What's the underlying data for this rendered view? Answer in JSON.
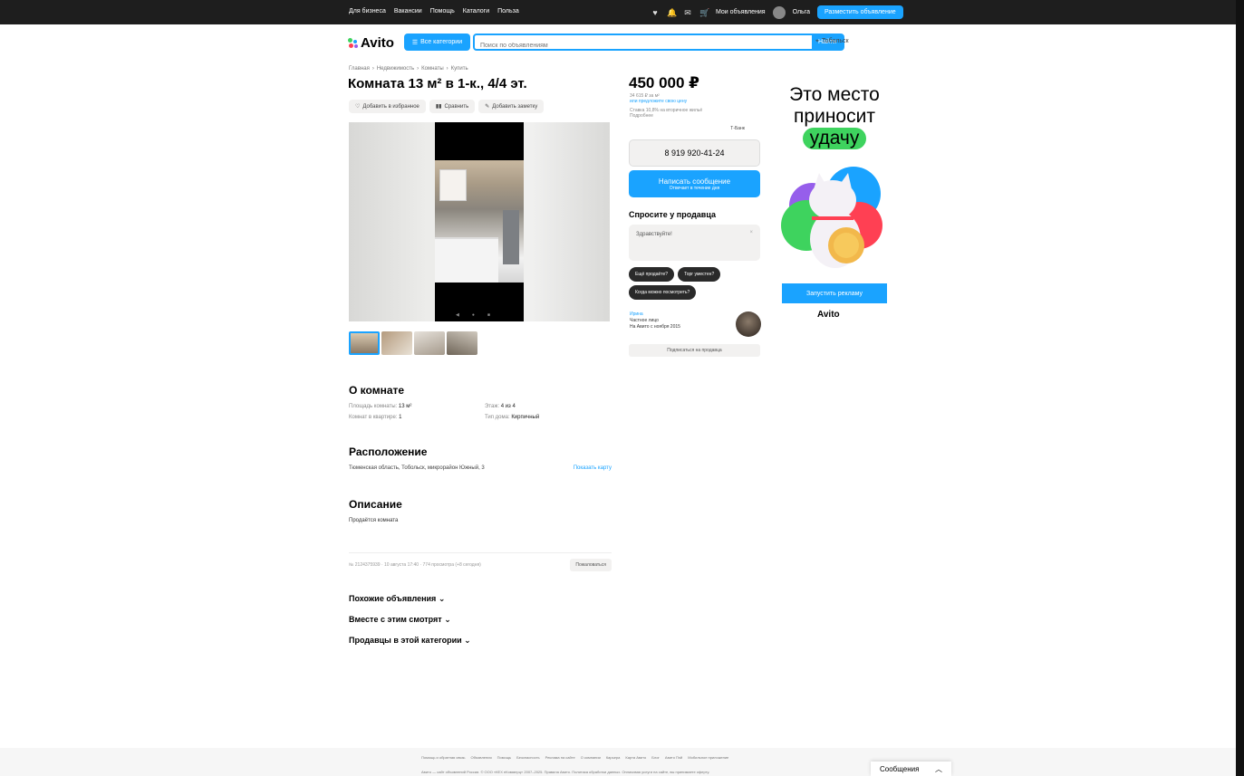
{
  "topbar": {
    "links": [
      "Для бизнеса",
      "Вакансии",
      "Помощь",
      "Каталоги",
      "Польза"
    ],
    "my_ads": "Мои объявления",
    "user": "Ольга",
    "publish": "Разместить объявление"
  },
  "header": {
    "logo": "Avito",
    "all_categories": "Все категории",
    "search_placeholder": "Поиск по объявлениям",
    "search_button": "Найти",
    "city": "Тобольск"
  },
  "breadcrumbs": [
    "Главная",
    "Недвижимость",
    "Комнаты",
    "Купить"
  ],
  "listing": {
    "title": "Комната 13 м² в 1-к., 4/4 эт.",
    "actions": [
      "Добавить в избранное",
      "Сравнить",
      "Добавить заметку"
    ],
    "price": "450 000 ₽",
    "price_per_m2": "34 615 ₽ за м²",
    "price_note": "или предложите свою цену",
    "mortgage": "Ставка 10,8% на вторичное жильё",
    "mortgage_more": "Подробнее",
    "bank": "Т-Банк",
    "phone": "8 919 920-41-24",
    "write": "Написать сообщение",
    "write_sub": "Отвечает в течение дня"
  },
  "ask": {
    "title": "Спросите у продавца",
    "placeholder": "Здравствуйте!",
    "chips": [
      "Ещё продаёте?",
      "Торг уместен?",
      "Когда можно посмотреть?"
    ]
  },
  "seller": {
    "name": "Ирина",
    "type": "Частное лицо",
    "since": "На Авито с ноября 2015",
    "subscribe": "Подписаться на продавца"
  },
  "about": {
    "title": "О комнате",
    "params": [
      {
        "k": "Площадь комнаты:",
        "v": "13 м²"
      },
      {
        "k": "Этаж:",
        "v": "4 из 4"
      },
      {
        "k": "Комнат в квартире:",
        "v": "1"
      },
      {
        "k": "Тип дома:",
        "v": "Кирпичный"
      }
    ]
  },
  "location": {
    "title": "Расположение",
    "address": "Тюменская область, Тобольск, микрорайон Южный, 3",
    "map_link": "Показать карту"
  },
  "description": {
    "title": "Описание",
    "text": "Продаётся комната"
  },
  "meta": {
    "info": "№ 2124375939 · 10 августа 17:40 · 774 просмотра (+8 сегодня)",
    "complain": "Пожаловаться"
  },
  "collapsibles": [
    "Похожие объявления",
    "Вместе с этим смотрят",
    "Продавцы в этой категории"
  ],
  "ad": {
    "line1": "Это место",
    "line2": "приносит",
    "line3": "удачу",
    "button": "Запустить рекламу",
    "logo": "Avito"
  },
  "footer": {
    "links": [
      "Помощь и обратная связь",
      "Объявления",
      "Помощь",
      "Безопасность",
      "Реклама на сайте",
      "О компании",
      "Карьера",
      "Карта Авито",
      "Блог",
      "Авито Пэй",
      "Мобильное приложение"
    ],
    "legal": "Авито — сайт объявлений России. © ООО «КЕХ еКоммерц» 2007–2025. Правила Авито. Политика обработки данных. Оплачивая услуги на сайте, вы принимаете оферту."
  },
  "messenger": {
    "label": "Сообщения"
  },
  "colors": {
    "accent": "#1aa3ff",
    "dark": "#1e1e1e",
    "green": "#3ed35e"
  }
}
